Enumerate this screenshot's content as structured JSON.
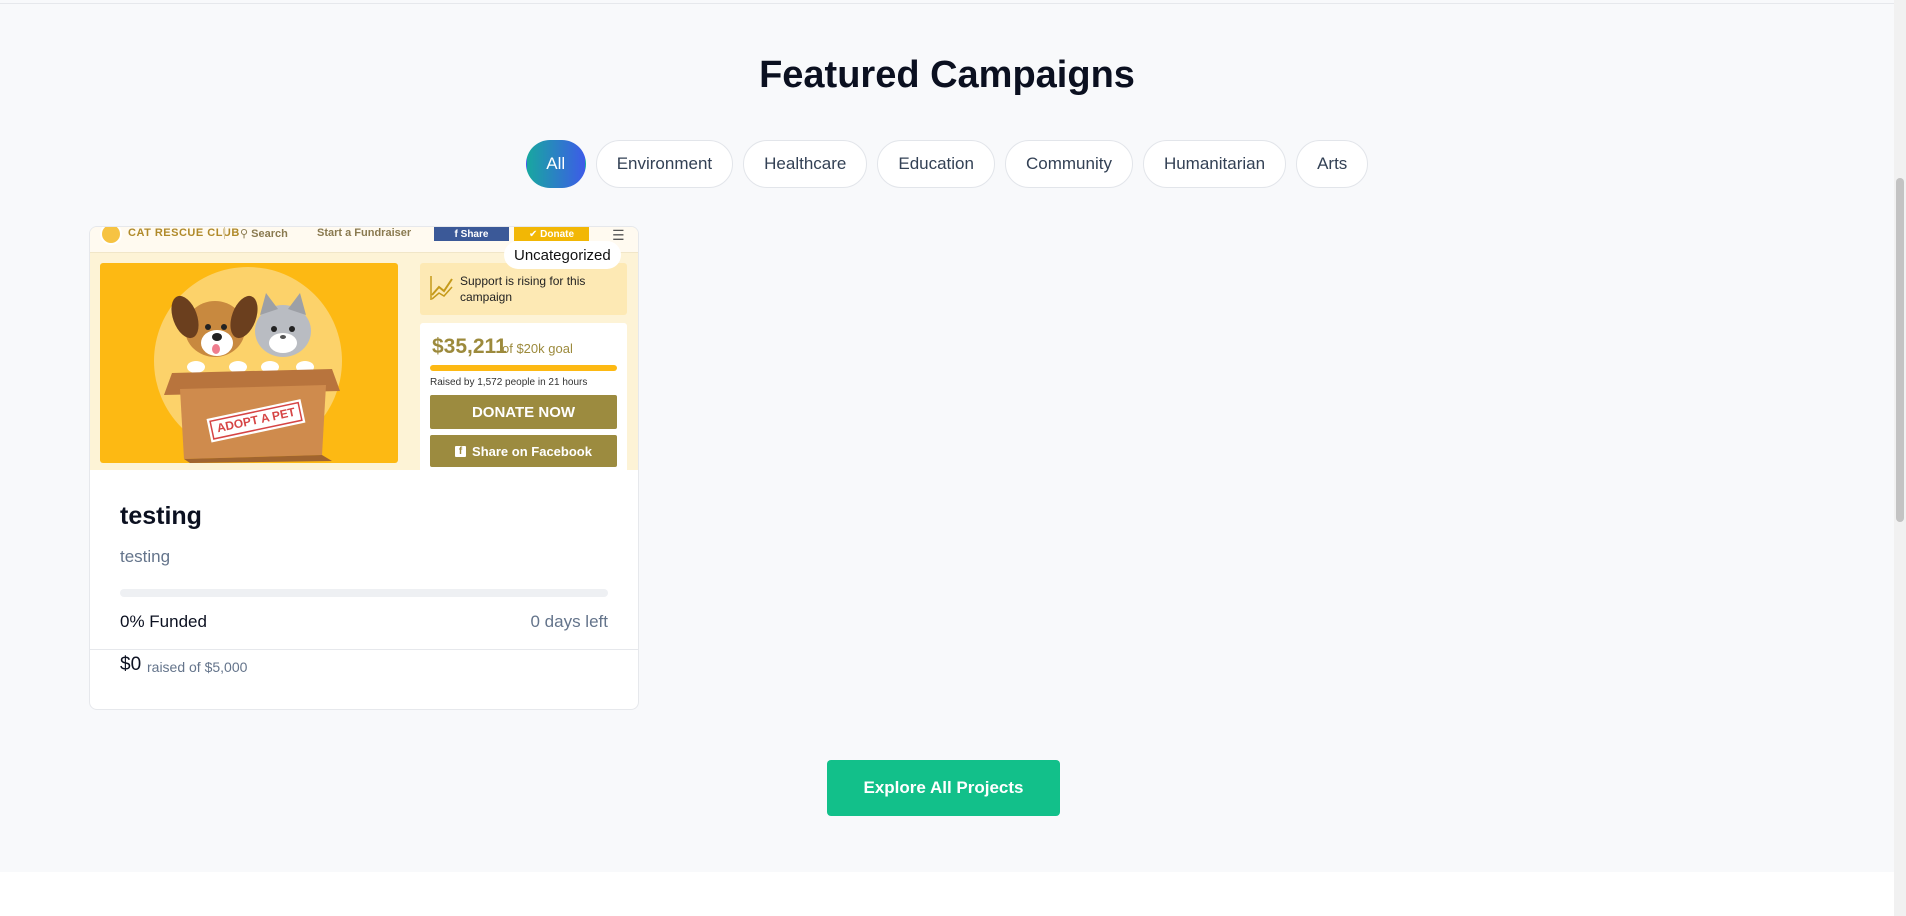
{
  "section": {
    "title": "Featured Campaigns",
    "filters": [
      {
        "label": "All",
        "active": true
      },
      {
        "label": "Environment",
        "active": false
      },
      {
        "label": "Healthcare",
        "active": false
      },
      {
        "label": "Education",
        "active": false
      },
      {
        "label": "Community",
        "active": false
      },
      {
        "label": "Humanitarian",
        "active": false
      },
      {
        "label": "Arts",
        "active": false
      }
    ],
    "explore_label": "Explore All Projects"
  },
  "campaign": {
    "category_badge": "Uncategorized",
    "title": "testing",
    "description": "testing",
    "funded_percent": 0,
    "funded_label": "0% Funded",
    "days_left": "0 days left",
    "raised_amount": "$0",
    "raised_of": "raised of $5,000",
    "thumbnail": {
      "logo_text": "CAT RESCUE CLUB",
      "nav_search": "Search",
      "nav_start": "Start a Fundraiser",
      "share_label": "Share",
      "donate_label": "Donate",
      "sign_text": "ADOPT A PET",
      "rising_text": "Support is rising for this campaign",
      "amount": "$35,211",
      "goal": "of $20k goal",
      "raised_by": "Raised by 1,572 people in 21 hours",
      "donate_now": "DONATE NOW",
      "share_facebook": "Share on Facebook"
    }
  },
  "colors": {
    "accent_green": "#12c08a",
    "chip_gradient_start": "#18a7a0",
    "chip_gradient_end": "#3d5be8",
    "thumb_yellow": "#fdb913",
    "thumb_olive": "#9c8b3f"
  },
  "icons": [
    "search-icon",
    "menu-icon",
    "check-icon",
    "trend-icon",
    "facebook-icon"
  ]
}
